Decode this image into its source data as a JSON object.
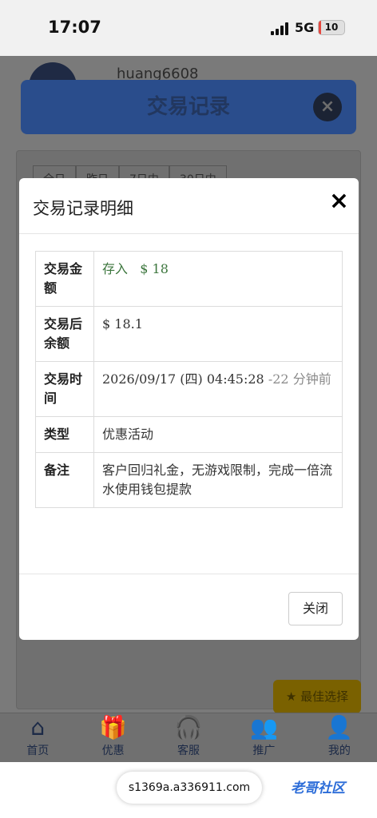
{
  "status_bar": {
    "time": "17:07",
    "network": "5G",
    "battery": "10",
    "battery_level": 0.1
  },
  "background": {
    "username": "huang6608",
    "header_title": "交易记录",
    "filters": [
      "全日",
      "昨日",
      "7日内",
      "30日内"
    ],
    "cta_label": "最佳选择",
    "nav_items": [
      {
        "icon": "home-icon",
        "glyph": "⌂",
        "label": "首页"
      },
      {
        "icon": "gift-icon",
        "glyph": "🎁",
        "label": "优惠"
      },
      {
        "icon": "headset-icon",
        "glyph": "🎧",
        "label": "客服"
      },
      {
        "icon": "user-add-icon",
        "glyph": "👥",
        "label": "推广"
      },
      {
        "icon": "account-icon",
        "glyph": "👤",
        "label": "我的"
      }
    ]
  },
  "modal": {
    "title": "交易记录明细",
    "close_glyph": "×",
    "rows": [
      {
        "key": "交易金额",
        "value_type": "存入",
        "value_amount": "$ 18"
      },
      {
        "key": "交易后余额",
        "value": "$ 18.1"
      },
      {
        "key": "交易时间",
        "value_date": "2026/09/17 (四) 04:45:28",
        "value_relative": "-22 分钟前"
      },
      {
        "key": "类型",
        "value": "优惠活动"
      },
      {
        "key": "备注",
        "value": "客户回归礼金，无游戏限制，完成一倍流水使用钱包提款"
      }
    ],
    "close_button": "关闭"
  },
  "browser": {
    "url": "s1369a.a336911.com",
    "watermark": "老哥社区"
  }
}
